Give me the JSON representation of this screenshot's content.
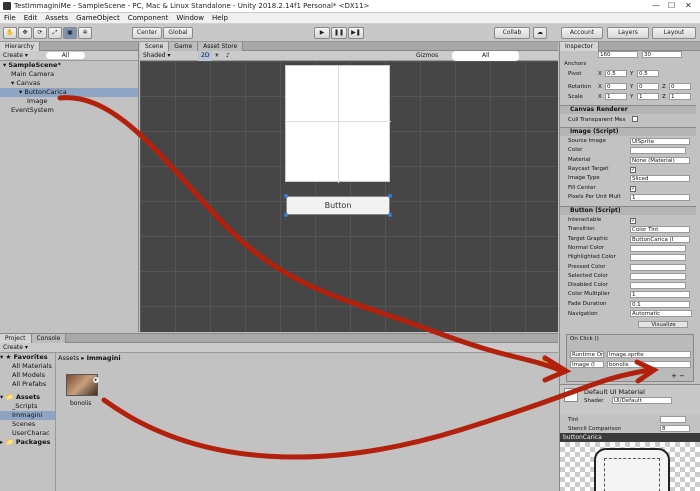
{
  "window": {
    "title": "TestImmaginiMe - SampleScene - PC, Mac & Linux Standalone - Unity 2018.2.14f1 Personal* <DX11>"
  },
  "menu": [
    "File",
    "Edit",
    "Assets",
    "GameObject",
    "Component",
    "Window",
    "Help"
  ],
  "toolbar": {
    "center": "Center",
    "global": "Global",
    "collab": "Collab",
    "account": "Account",
    "layers": "Layers",
    "layout": "Layout"
  },
  "hierarchy": {
    "tab": "Hierarchy",
    "create": "Create",
    "search": "All",
    "items": [
      {
        "label": "SampleScene*",
        "indent": 0
      },
      {
        "label": "Main Camera",
        "indent": 1
      },
      {
        "label": "Canvas",
        "indent": 1
      },
      {
        "label": "ButtonCarica",
        "indent": 2
      },
      {
        "label": "Image",
        "indent": 3
      },
      {
        "label": "EventSystem",
        "indent": 1
      }
    ]
  },
  "scene": {
    "tabs": [
      "Scene",
      "Game",
      "Asset Store"
    ],
    "shaded": "Shaded",
    "mode": "2D",
    "gizmos": "Gizmos",
    "search": "All",
    "button_text": "Button"
  },
  "inspector": {
    "tab": "Inspector",
    "anchors": "Anchors",
    "top_values": [
      "160",
      "30"
    ],
    "pivot": {
      "label": "Pivot",
      "x": "0.5",
      "y": "0.5"
    },
    "rotation": {
      "label": "Rotation",
      "x": "0",
      "y": "0",
      "z": "0"
    },
    "scale": {
      "label": "Scale",
      "x": "1",
      "y": "1",
      "z": "1"
    },
    "canvas_renderer": {
      "title": "Canvas Renderer",
      "cull": "Cull Transparent Mes"
    },
    "image": {
      "title": "Image (Script)",
      "rows": [
        {
          "label": "Source Image",
          "value": "UISprite"
        },
        {
          "label": "Color",
          "value": ""
        },
        {
          "label": "Material",
          "value": "None (Material)"
        },
        {
          "label": "Raycast Target",
          "value": "✓"
        },
        {
          "label": "Image Type",
          "value": "Sliced"
        },
        {
          "label": "Fill Center",
          "value": "✓"
        },
        {
          "label": "Pixels Per Unit Mult",
          "value": "1"
        }
      ]
    },
    "button": {
      "title": "Button (Script)",
      "rows": [
        {
          "label": "Interactable",
          "value": "✓"
        },
        {
          "label": "Transition",
          "value": "Color Tint"
        },
        {
          "label": "Target Graphic",
          "value": "ButtonCarica (I"
        },
        {
          "label": "Normal Color",
          "value": ""
        },
        {
          "label": "Highlighted Color",
          "value": ""
        },
        {
          "label": "Pressed Color",
          "value": ""
        },
        {
          "label": "Selected Color",
          "value": ""
        },
        {
          "label": "Disabled Color",
          "value": ""
        },
        {
          "label": "Color Multiplier",
          "value": "1"
        },
        {
          "label": "Fade Duration",
          "value": "0.1"
        }
      ],
      "navigation": {
        "label": "Navigation",
        "value": "Automatic",
        "visualize": "Visualize"
      },
      "onclick": "On Click ()",
      "runtime": "Runtime Or",
      "function": "Image.sprite",
      "target": "Image (I",
      "target_obj": "bonolis"
    },
    "material": {
      "title": "Default UI Material",
      "shader_label": "Shader",
      "shader_value": "UI/Default",
      "tint": "Tint",
      "stencil": "Stencil Comparison",
      "stencil_val": "8"
    },
    "preview": {
      "title": "buttonCarica"
    }
  },
  "project": {
    "tabs": [
      "Project",
      "Console"
    ],
    "create": "Create",
    "favorites": {
      "title": "Favorites",
      "items": [
        "All Materials",
        "All Models",
        "All Prefabs"
      ]
    },
    "assets": {
      "title": "Assets",
      "items": [
        "_Scripts",
        "Immagini",
        "Scenes",
        "UserCharac"
      ]
    },
    "packages": "Packages",
    "breadcrumb": [
      "Assets",
      "Immagini"
    ],
    "asset_name": "bonolis"
  },
  "colors": {
    "scene_bg": "#464646",
    "arrow": "#b3200c",
    "selection": "#8ea4c4"
  }
}
